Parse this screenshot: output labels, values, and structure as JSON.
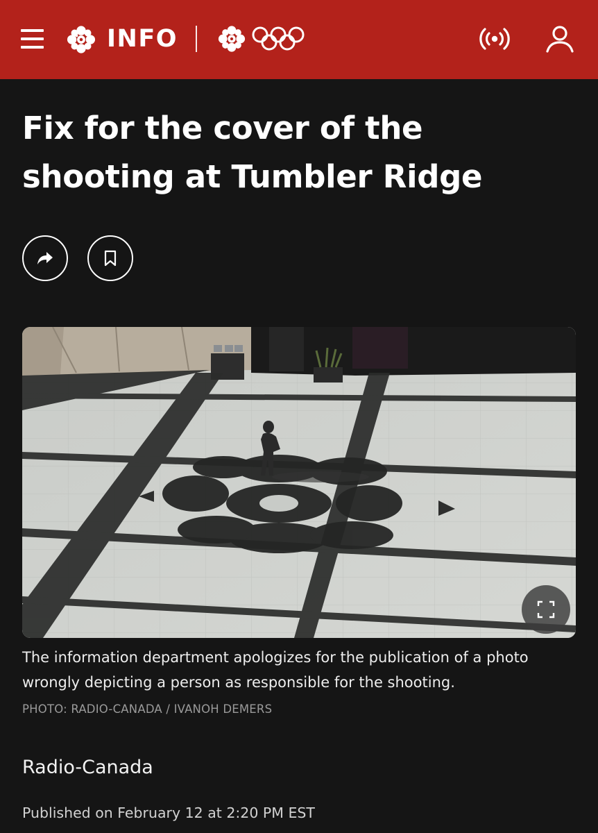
{
  "header": {
    "brand_label": "INFO",
    "bar_color": "#b3221b",
    "icons": {
      "menu": "hamburger-menu-icon",
      "logo": "cbc-gem-logo-icon",
      "olympics": "olympic-rings-icon",
      "live": "live-radio-icon",
      "account": "account-user-icon"
    }
  },
  "article": {
    "title": "Fix for the cover of the shooting at Tumbler Ridge",
    "actions": {
      "share_icon": "share-arrow-icon",
      "bookmark_icon": "bookmark-icon"
    },
    "photo": {
      "alt": "Person walking on a plaza floor with the shadow of the CBC gem logo",
      "fullscreen_icon": "fullscreen-expand-icon"
    },
    "caption": "The information department apologizes for the publication of a photo wrongly depicting a person as responsible for the shooting.",
    "credit": "PHOTO: RADIO-CANADA / IVANOH DEMERS",
    "source": "Radio-Canada",
    "published": "Published on February 12 at 2:20 PM EST"
  }
}
